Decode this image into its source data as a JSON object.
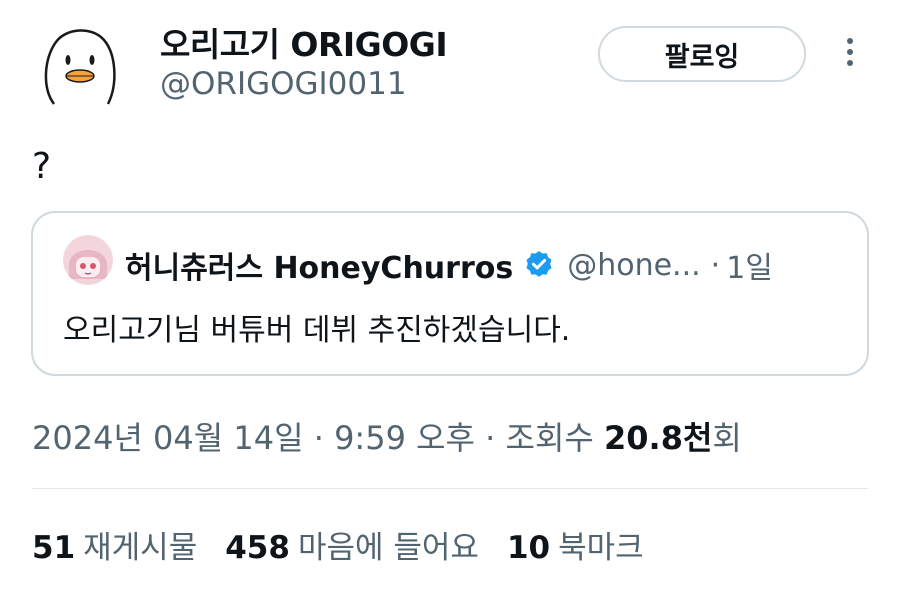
{
  "author": {
    "display_name": "오리고기 ORIGOGI",
    "handle": "@ORIGOGI0011",
    "avatar_icon": "duck-avatar-icon"
  },
  "follow_button": {
    "label": "팔로잉"
  },
  "more_menu": {
    "icon": "more-vertical-icon"
  },
  "tweet": {
    "text": "?"
  },
  "quoted_tweet": {
    "display_name": "허니츄러스 HoneyChurros",
    "verified": true,
    "handle": "@hone...",
    "separator": "·",
    "time": "1일",
    "text": "오리고기님 버튜버 데뷔 추진하겠습니다."
  },
  "meta": {
    "date": "2024년 04월 14일",
    "sep1": "·",
    "time": "9:59 오후",
    "sep2": "·",
    "views_label": "조회수",
    "views_value": "20.8천",
    "views_suffix": "회"
  },
  "stats": {
    "retweets_count": "51",
    "retweets_label": "재게시물",
    "likes_count": "458",
    "likes_label": "마음에 들어요",
    "bookmarks_count": "10",
    "bookmarks_label": "북마크"
  },
  "colors": {
    "text_primary": "#0f1419",
    "text_secondary": "#536471",
    "border": "#cfd9de",
    "verified_blue": "#1d9bf0",
    "duck_beak": "#f5a23c"
  }
}
